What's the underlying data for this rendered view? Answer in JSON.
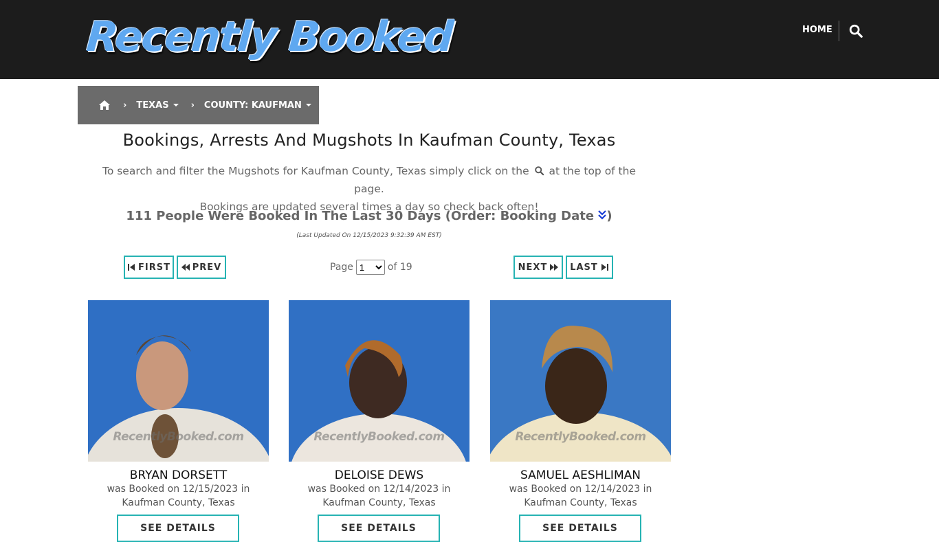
{
  "header": {
    "logo_text": "Recently Booked",
    "nav_home": "HOME",
    "search_icon": "search-icon"
  },
  "breadcrumb": {
    "home_icon": "home-icon",
    "state": "TEXAS",
    "county": "COUNTY: KAUFMAN"
  },
  "main": {
    "title": "Bookings, Arrests And Mugshots In Kaufman County, Texas",
    "intro_part1": "To search and filter the Mugshots for Kaufman County, Texas simply click on the",
    "intro_part2": "at the top of the page.",
    "intro_line2": "Bookings are updated several times a day so check back often!",
    "count_text": "111 People Were Booked In The Last 30 Days (Order: Booking Date",
    "count_close": ")",
    "updated": "(Last Updated On 12/15/2023 9:32:39 AM EST)"
  },
  "pagination": {
    "first": "FIRST",
    "prev": "PREV",
    "next": "NEXT",
    "last": "LAST",
    "page_label": "Page",
    "current_page": "1",
    "of_label": "of 19"
  },
  "cards": [
    {
      "name": "BRYAN DORSETT",
      "booked": "was Booked on 12/15/2023 in",
      "location": "Kaufman County, Texas",
      "watermark": "RecentlyBooked.com",
      "button": "SEE DETAILS"
    },
    {
      "name": "DELOISE DEWS",
      "booked": "was Booked on 12/14/2023 in",
      "location": "Kaufman County, Texas",
      "watermark": "RecentlyBooked.com",
      "button": "SEE DETAILS"
    },
    {
      "name": "SAMUEL AESHLIMAN",
      "booked": "was Booked on 12/14/2023 in",
      "location": "Kaufman County, Texas",
      "watermark": "RecentlyBooked.com",
      "button": "SEE DETAILS"
    }
  ],
  "colors": {
    "topbar": "#1c1c1c",
    "breadcrumb_bg": "#6b6b6b",
    "button_border": "#26b3b3",
    "photo_backdrop": "#2f6fc4"
  }
}
